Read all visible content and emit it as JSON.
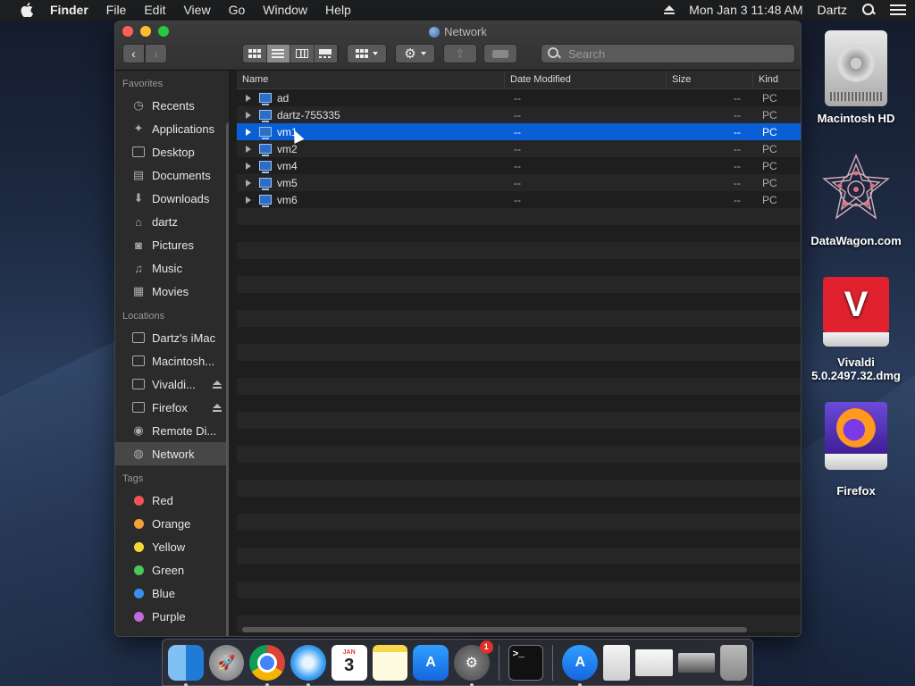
{
  "menubar": {
    "app_name": "Finder",
    "items": [
      "File",
      "Edit",
      "View",
      "Go",
      "Window",
      "Help"
    ],
    "datetime": "Mon Jan 3  11:48 AM",
    "user": "Dartz"
  },
  "window": {
    "title": "Network",
    "search_placeholder": "Search",
    "columns": {
      "name": "Name",
      "date": "Date Modified",
      "size": "Size",
      "kind": "Kind"
    }
  },
  "sidebar": {
    "favorites_header": "Favorites",
    "favorites": [
      {
        "label": "Recents",
        "icon": "clock-icon"
      },
      {
        "label": "Applications",
        "icon": "applications-icon"
      },
      {
        "label": "Desktop",
        "icon": "desktop-icon"
      },
      {
        "label": "Documents",
        "icon": "documents-icon"
      },
      {
        "label": "Downloads",
        "icon": "downloads-icon"
      },
      {
        "label": "dartz",
        "icon": "home-icon"
      },
      {
        "label": "Pictures",
        "icon": "camera-icon"
      },
      {
        "label": "Music",
        "icon": "music-note-icon"
      },
      {
        "label": "Movies",
        "icon": "film-icon"
      }
    ],
    "locations_header": "Locations",
    "locations": [
      {
        "label": "Dartz's iMac",
        "icon": "imac-icon"
      },
      {
        "label": "Macintosh...",
        "icon": "disk-icon"
      },
      {
        "label": "Vivaldi...",
        "icon": "disk-icon",
        "eject": true
      },
      {
        "label": "Firefox",
        "icon": "disk-icon",
        "eject": true
      },
      {
        "label": "Remote Di...",
        "icon": "remote-disc-icon"
      },
      {
        "label": "Network",
        "icon": "network-globe-icon",
        "selected": true
      }
    ],
    "tags_header": "Tags",
    "tags": [
      {
        "label": "Red",
        "color": "#f0545a"
      },
      {
        "label": "Orange",
        "color": "#f2a23a"
      },
      {
        "label": "Yellow",
        "color": "#f3d838"
      },
      {
        "label": "Green",
        "color": "#46c85a"
      },
      {
        "label": "Blue",
        "color": "#3a8ef0"
      },
      {
        "label": "Purple",
        "color": "#c06ae0"
      }
    ]
  },
  "files": [
    {
      "name": "ad",
      "date": "--",
      "size": "--",
      "kind": "PC"
    },
    {
      "name": "dartz-755335",
      "date": "--",
      "size": "--",
      "kind": "PC"
    },
    {
      "name": "vm1",
      "date": "--",
      "size": "--",
      "kind": "PC",
      "selected": true
    },
    {
      "name": "vm2",
      "date": "--",
      "size": "--",
      "kind": "PC"
    },
    {
      "name": "vm4",
      "date": "--",
      "size": "--",
      "kind": "PC"
    },
    {
      "name": "vm5",
      "date": "--",
      "size": "--",
      "kind": "PC"
    },
    {
      "name": "vm6",
      "date": "--",
      "size": "--",
      "kind": "PC"
    }
  ],
  "desktop": {
    "icons": [
      {
        "label": "Macintosh HD"
      },
      {
        "label": "DataWagon.com"
      },
      {
        "label": "Vivaldi 5.0.2497.32.dmg"
      },
      {
        "label": "Firefox"
      }
    ]
  },
  "dock": {
    "calendar_month": "JAN",
    "calendar_day": "3",
    "prefs_badge": "1",
    "terminal_prompt": ">_"
  }
}
